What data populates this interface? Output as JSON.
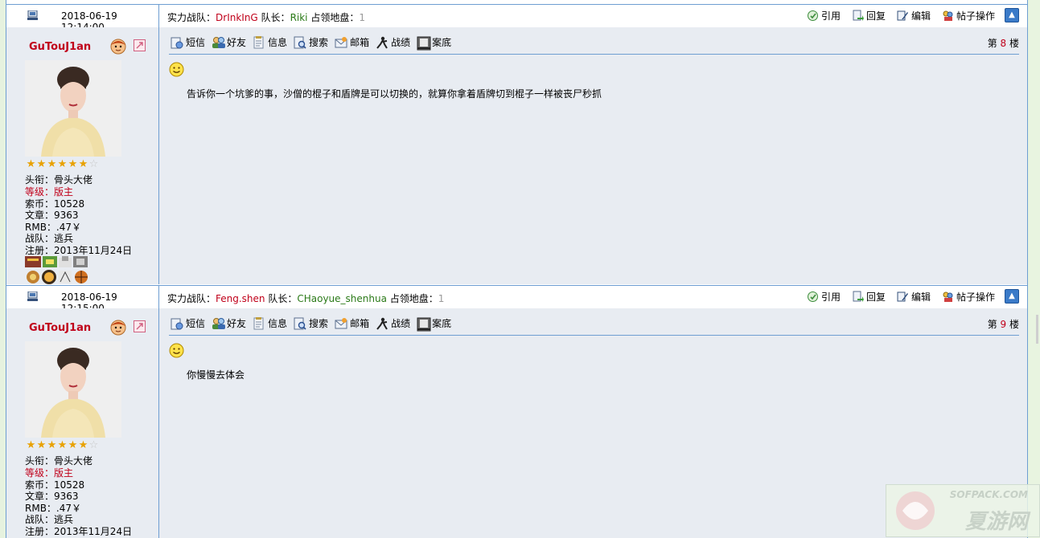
{
  "posts": [
    {
      "time": "2018-06-19 12:14:00",
      "info": {
        "team_label": "实力战队：",
        "team": "DrInkInG",
        "captain_label": " 队长：",
        "captain": "Riki",
        "territory_label": " 占领地盘：",
        "territory": "1"
      },
      "user": {
        "name": "GuTouJ1an",
        "stars_filled": 6,
        "stars_total": 7,
        "title": "头衔：骨头大佬",
        "level": "等级：版主",
        "coins": "索币：10528",
        "articles": "文章：9363",
        "rmb": "RMB：.47￥",
        "team": "战队：逃兵",
        "registered": "注册：2013年11月24日"
      },
      "floor_prefix": "第 ",
      "floor": "8",
      "floor_suffix": " 楼",
      "message": "告诉你一个坑爹的事，沙僧的棍子和盾牌是可以切换的，就算你拿着盾牌切到棍子一样被丧尸秒抓"
    },
    {
      "time": "2018-06-19 12:15:00",
      "info": {
        "team_label": "实力战队：",
        "team": "Feng.shen",
        "captain_label": " 队长：",
        "captain": "CHaoyue_shenhua",
        "territory_label": " 占领地盘：",
        "territory": "1"
      },
      "user": {
        "name": "GuTouJ1an",
        "stars_filled": 6,
        "stars_total": 7,
        "title": "头衔：骨头大佬",
        "level": "等级：版主",
        "coins": "索币：10528",
        "articles": "文章：9363",
        "rmb": "RMB：.47￥",
        "team": "战队：逃兵",
        "registered": "注册：2013年11月24日"
      },
      "floor_prefix": "第 ",
      "floor": "9",
      "floor_suffix": " 楼",
      "message": "你慢慢去体会"
    }
  ],
  "actions": {
    "quote": "引用",
    "reply": "回复",
    "edit": "编辑",
    "post_ops": "帖子操作"
  },
  "toolbar": {
    "sms": "短信",
    "friend": "好友",
    "info": "信息",
    "search": "搜索",
    "mail": "邮箱",
    "record": "战绩",
    "case": "案底"
  },
  "watermark": {
    "line1": "SOFPACK.COM",
    "line2": "夏游网"
  }
}
